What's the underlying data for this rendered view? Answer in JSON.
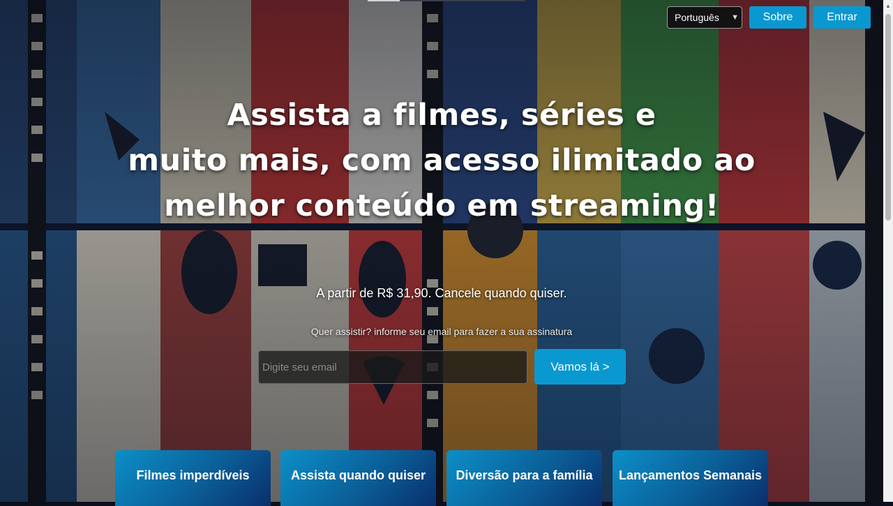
{
  "header": {
    "language_selected": "Português",
    "about_label": "Sobre",
    "login_label": "Entrar"
  },
  "hero": {
    "title_line1": "Assista a filmes, séries e",
    "title_line2": "muito mais, com acesso ilimitado ao",
    "title_line3": "melhor conteúdo em streaming!",
    "price_text": "A partir de R$ 31,90. Cancele quando quiser.",
    "signup_hint": "Quer assistir? informe seu email para fazer a sua assinatura",
    "email_placeholder": "Digite seu email",
    "cta_label": "Vamos lá >"
  },
  "features": [
    {
      "label": "Filmes imperdíveis"
    },
    {
      "label": "Assista quando quiser"
    },
    {
      "label": "Diversão para a família"
    },
    {
      "label": "Lançamentos Semanais"
    }
  ],
  "colors": {
    "accent": "#0a98d1",
    "background": "#0b0f1c"
  }
}
